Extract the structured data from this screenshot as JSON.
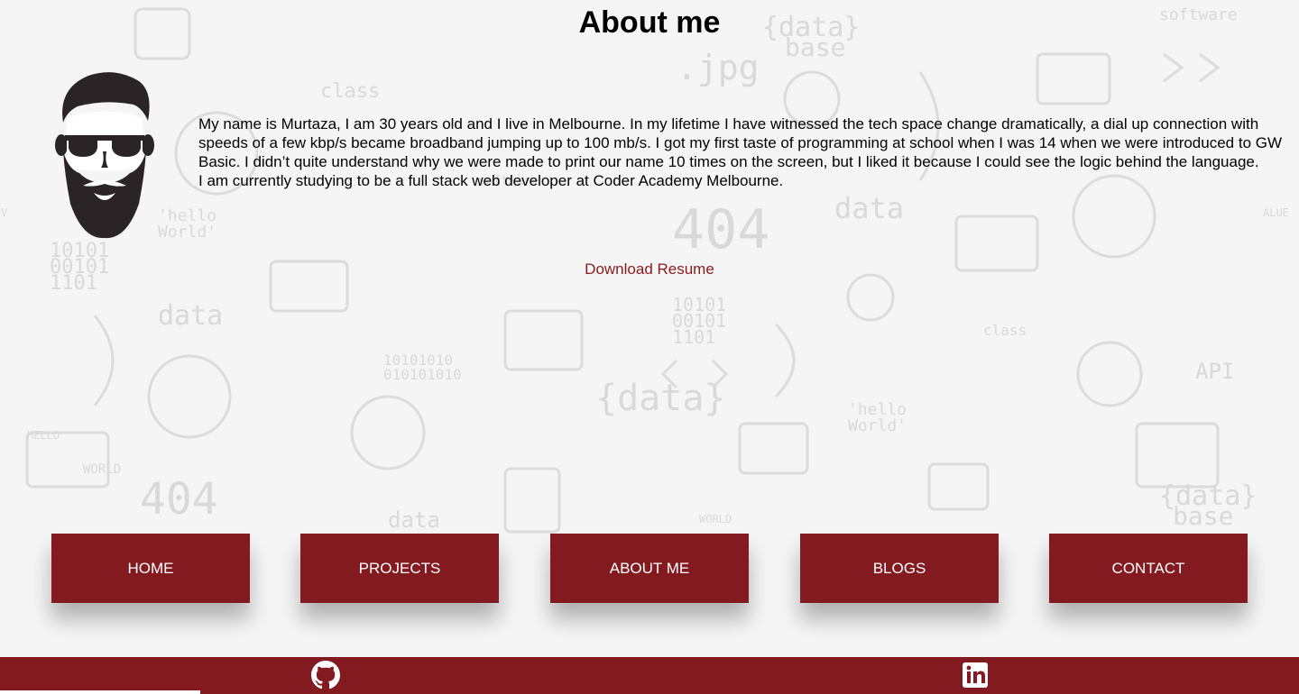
{
  "page": {
    "title": "About me"
  },
  "about": {
    "bio_paragraph_1": "My name is Murtaza, I am 30 years old and I live in Melbourne. In my lifetime I have witnessed the tech space change dramatically, a dial up connection with speeds of a few kbp/s became broadband jumping up to 100 mb/s. I got my first taste of programming at school when I was 14 when we were introduced to GW Basic. I didn’t quite understand why we were made to print our name 10 times on the screen, but I liked it because I could see the logic behind the language.",
    "bio_paragraph_2": "I am currently studying to be a full stack web developer at Coder Academy Melbourne.",
    "download_label": "Download Resume"
  },
  "nav": {
    "items": [
      {
        "label": "HOME"
      },
      {
        "label": "PROJECTS"
      },
      {
        "label": "ABOUT ME"
      },
      {
        "label": "BLOGS"
      },
      {
        "label": "CONTACT"
      }
    ]
  },
  "footer": {
    "icons": [
      "github-icon",
      "linkedin-icon"
    ]
  },
  "colors": {
    "brand": "#831a1f",
    "link": "#8b1a1f",
    "background": "#f5f5f5"
  },
  "background_doodles": [
    "data base",
    "jpg",
    "class",
    "software",
    "hello World",
    "10101",
    "404",
    "data",
    "HELLO",
    "WORLD",
    "API"
  ]
}
